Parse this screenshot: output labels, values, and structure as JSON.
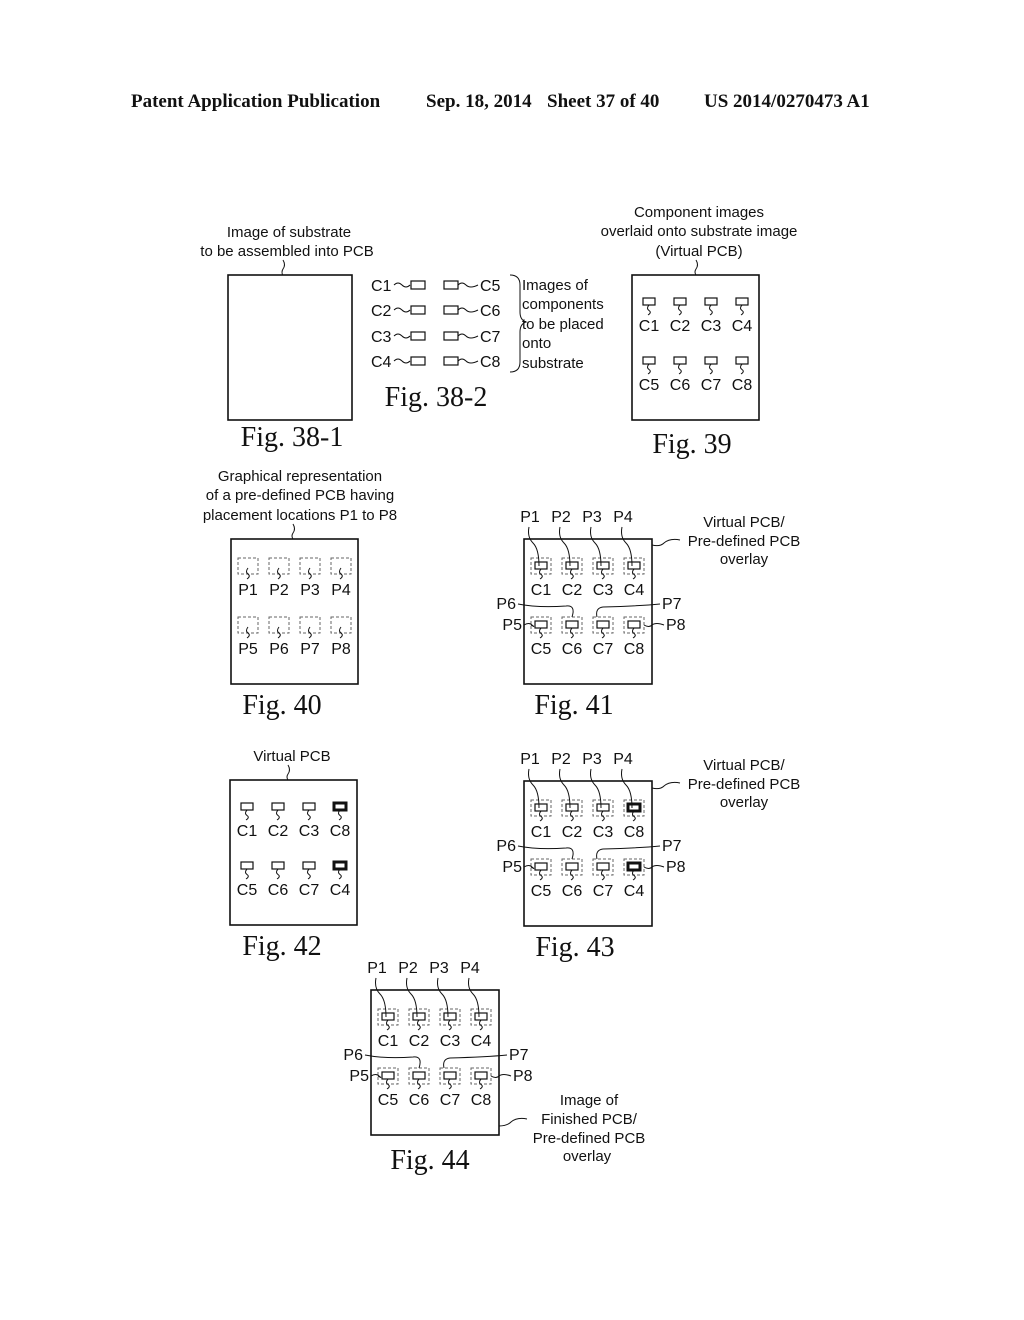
{
  "header": {
    "left": "Patent Application Publication",
    "date": "Sep. 18, 2014",
    "sheet": "Sheet 37 of 40",
    "number": "US 2014/0270473 A1"
  },
  "figures": {
    "fig38_1": {
      "caption": "Fig. 38-1",
      "label_lines": [
        "Image of substrate",
        "to be assembled into PCB"
      ]
    },
    "fig38_2": {
      "caption": "Fig. 38-2",
      "left_components": [
        "C1",
        "C2",
        "C3",
        "C4"
      ],
      "right_components": [
        "C5",
        "C6",
        "C7",
        "C8"
      ],
      "brace_label_lines": [
        "Images of",
        "components",
        "to be placed",
        "onto",
        "substrate"
      ]
    },
    "fig39": {
      "caption": "Fig. 39",
      "label_lines": [
        "Component images",
        "overlaid onto substrate image",
        "(Virtual PCB)"
      ],
      "row1": [
        "C1",
        "C2",
        "C3",
        "C4"
      ],
      "row2": [
        "C5",
        "C6",
        "C7",
        "C8"
      ]
    },
    "fig40": {
      "caption": "Fig. 40",
      "label_lines": [
        "Graphical representation",
        "of a pre-defined PCB having",
        "placement locations P1 to P8"
      ],
      "row1": [
        "P1",
        "P2",
        "P3",
        "P4"
      ],
      "row2": [
        "P5",
        "P6",
        "P7",
        "P8"
      ]
    },
    "fig41": {
      "caption": "Fig. 41",
      "label_lines": [
        "Virtual PCB/",
        "Pre-defined PCB",
        "overlay"
      ],
      "top_locations": [
        "P1",
        "P2",
        "P3",
        "P4"
      ],
      "row1": [
        "C1",
        "C2",
        "C3",
        "C4"
      ],
      "row2": [
        "C5",
        "C6",
        "C7",
        "C8"
      ],
      "side_locations": {
        "p5": "P5",
        "p6": "P6",
        "p7": "P7",
        "p8": "P8"
      },
      "highlighted": []
    },
    "fig42": {
      "caption": "Fig. 42",
      "label_lines": [
        "Virtual PCB"
      ],
      "row1": [
        "C1",
        "C2",
        "C3",
        "C8"
      ],
      "row2": [
        "C5",
        "C6",
        "C7",
        "C4"
      ],
      "highlighted": [
        "C8",
        "C4"
      ]
    },
    "fig43": {
      "caption": "Fig. 43",
      "label_lines": [
        "Virtual PCB/",
        "Pre-defined PCB",
        "overlay"
      ],
      "top_locations": [
        "P1",
        "P2",
        "P3",
        "P4"
      ],
      "row1": [
        "C1",
        "C2",
        "C3",
        "C8"
      ],
      "row2": [
        "C5",
        "C6",
        "C7",
        "C4"
      ],
      "side_locations": {
        "p5": "P5",
        "p6": "P6",
        "p7": "P7",
        "p8": "P8"
      },
      "highlighted": [
        "C8",
        "C4"
      ]
    },
    "fig44": {
      "caption": "Fig. 44",
      "label_lines": [
        "Image of",
        "Finished PCB/",
        "Pre-defined PCB",
        "overlay"
      ],
      "top_locations": [
        "P1",
        "P2",
        "P3",
        "P4"
      ],
      "row1": [
        "C1",
        "C2",
        "C3",
        "C4"
      ],
      "row2": [
        "C5",
        "C6",
        "C7",
        "C8"
      ],
      "side_locations": {
        "p5": "P5",
        "p6": "P6",
        "p7": "P7",
        "p8": "P8"
      },
      "highlighted": []
    }
  }
}
